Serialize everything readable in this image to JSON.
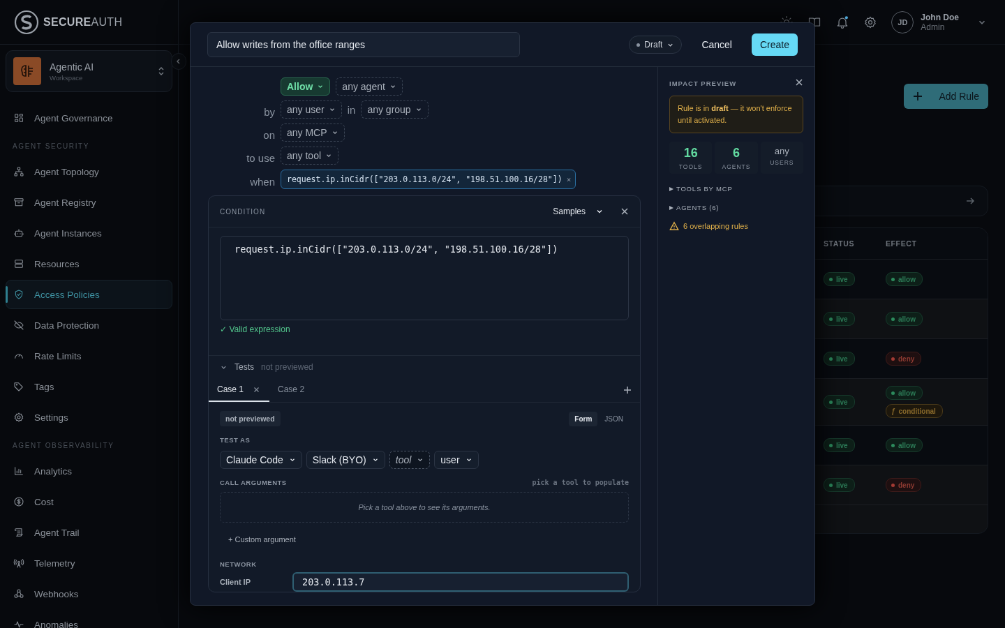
{
  "brand": {
    "name": "**SECURE**AUTH"
  },
  "header": {
    "notifications_unread": true,
    "user": {
      "initials": "JD",
      "name": "John Doe",
      "role": "Admin"
    }
  },
  "workspace": {
    "name": "Agentic AI",
    "subtitle": "Workspace"
  },
  "nav": [
    {
      "kind": "item",
      "label": "Agent Governance",
      "selected": false
    },
    {
      "kind": "section",
      "label": "AGENT SECURITY"
    },
    {
      "kind": "item",
      "label": "Agent Topology",
      "selected": false
    },
    {
      "kind": "item",
      "label": "Agent Registry",
      "selected": false
    },
    {
      "kind": "item",
      "label": "Agent Instances",
      "selected": false
    },
    {
      "kind": "item",
      "label": "Resources",
      "selected": false
    },
    {
      "kind": "item",
      "label": "Access Policies",
      "selected": true
    },
    {
      "kind": "item",
      "label": "Data Protection",
      "selected": false
    },
    {
      "kind": "item",
      "label": "Rate Limits",
      "selected": false
    },
    {
      "kind": "item",
      "label": "Tags",
      "selected": false
    },
    {
      "kind": "item",
      "label": "Settings",
      "selected": false
    },
    {
      "kind": "section",
      "label": "AGENT OBSERVABILITY"
    },
    {
      "kind": "item",
      "label": "Analytics",
      "selected": false
    },
    {
      "kind": "item",
      "label": "Cost",
      "selected": false
    },
    {
      "kind": "item",
      "label": "Agent Trail",
      "selected": false
    },
    {
      "kind": "item",
      "label": "Telemetry",
      "selected": false
    },
    {
      "kind": "item",
      "label": "Webhooks",
      "selected": false
    },
    {
      "kind": "item",
      "label": "Anomalies",
      "selected": false
    }
  ],
  "page": {
    "add_button": "Add Rule",
    "table": {
      "columns": [
        "STATUS",
        "EFFECT"
      ],
      "rows": [
        {
          "status": "live",
          "effects": [
            {
              "kind": "allow",
              "label": "allow"
            }
          ]
        },
        {
          "status": "live",
          "effects": [
            {
              "kind": "allow",
              "label": "allow"
            }
          ]
        },
        {
          "status": "live",
          "effects": [
            {
              "kind": "deny",
              "label": "deny"
            }
          ]
        },
        {
          "status": "live",
          "effects": [
            {
              "kind": "allow",
              "label": "allow"
            },
            {
              "kind": "conditional",
              "symbol": "ƒ",
              "label": "conditional"
            }
          ]
        },
        {
          "status": "live",
          "effects": [
            {
              "kind": "allow",
              "label": "allow"
            }
          ]
        },
        {
          "status": "live",
          "effects": [
            {
              "kind": "deny",
              "label": "deny"
            }
          ]
        }
      ]
    }
  },
  "modal": {
    "title_value": "Allow writes from the office ranges",
    "state": "Draft",
    "cancel": "Cancel",
    "create": "Create",
    "builder": [
      {
        "parts": [
          {
            "kind": "effect",
            "text": "Allow"
          },
          {
            "kind": "chip",
            "text": "any agent"
          }
        ]
      },
      {
        "label": "by",
        "parts": [
          {
            "kind": "chip",
            "text": "any user"
          },
          {
            "kind": "word",
            "text": "in"
          },
          {
            "kind": "chip",
            "text": "any group"
          }
        ]
      },
      {
        "label": "on",
        "parts": [
          {
            "kind": "chip",
            "text": "any MCP"
          }
        ]
      },
      {
        "label": "to use",
        "parts": [
          {
            "kind": "chip",
            "text": "any tool"
          }
        ]
      },
      {
        "label": "when",
        "parts": [
          {
            "kind": "expression",
            "text": "request.ip.inCidr([\"203.0.113.0/24\", \"198.51.100.16/28\"])",
            "remove": "×"
          }
        ]
      }
    ],
    "condition": {
      "title": "CONDITION",
      "samples": "Samples",
      "code": "request.ip.inCidr([\"203.0.113.0/24\", \"198.51.100.16/28\"])",
      "valid_mark": "✓",
      "valid_message": "Valid expression"
    },
    "tests": {
      "title": "Tests",
      "status": "not previewed",
      "expanded": true,
      "cases": [
        {
          "label": "Case 1",
          "selected": true
        },
        {
          "label": "Case 2",
          "selected": false
        }
      ],
      "badge": "not previewed",
      "modes": [
        {
          "label": "Form",
          "selected": true
        },
        {
          "label": "JSON",
          "selected": false
        }
      ],
      "test_as": "TEST AS",
      "selectors": [
        {
          "kind": "value",
          "text": "Claude Code"
        },
        {
          "kind": "value",
          "text": "Slack (BYO)"
        },
        {
          "kind": "placeholder",
          "text": "tool"
        },
        {
          "kind": "value",
          "text": "user"
        }
      ],
      "call_arguments": "CALL ARGUMENTS",
      "call_hint": "pick a tool to populate",
      "call_empty": "Pick a tool above to see its arguments.",
      "custom_argument": "+ Custom argument",
      "network": "NETWORK",
      "fields": [
        {
          "label": "Client IP",
          "value": "203.0.113.7"
        }
      ]
    },
    "impact": {
      "title": "IMPACT PREVIEW",
      "notice": "Rule is in **draft** — it won't enforce until activated.",
      "stats": [
        {
          "value": "16",
          "label": "TOOLS",
          "kind": "count"
        },
        {
          "value": "6",
          "label": "AGENTS",
          "kind": "count"
        },
        {
          "value": "any",
          "label": "USERS",
          "kind": "any"
        }
      ],
      "sections": [
        {
          "label": "TOOLS BY MCP",
          "expanded": false
        },
        {
          "label": "AGENTS (6)",
          "expanded": false
        }
      ],
      "warning": "6 overlapping rules"
    }
  }
}
